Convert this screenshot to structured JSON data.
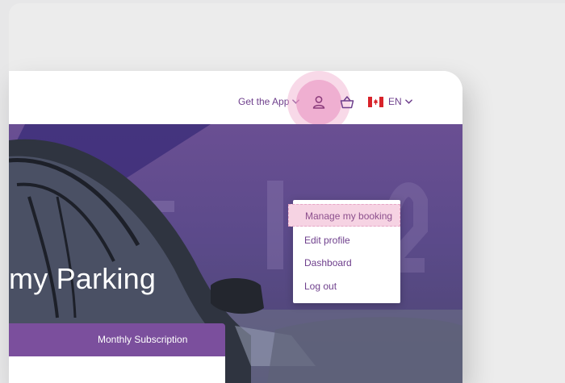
{
  "header": {
    "get_app_label": "Get the App",
    "language_label": "EN",
    "icons": [
      "user-icon",
      "basket-icon",
      "canada-flag-icon",
      "chevron-down-icon"
    ]
  },
  "hero": {
    "title": "my Parking"
  },
  "tabs": {
    "monthly_label": "Monthly Subscription"
  },
  "account_menu": {
    "items": [
      {
        "label": "Manage my booking"
      },
      {
        "label": "Edit profile"
      },
      {
        "label": "Dashboard"
      },
      {
        "label": "Log out"
      }
    ]
  },
  "colors": {
    "accent": "#6e3f8c",
    "tab_purple": "#7b4f9d",
    "hero_purple": "#5b4a8a",
    "highlight_pink": "#f6d3e3",
    "flag_red": "#d8232a"
  }
}
